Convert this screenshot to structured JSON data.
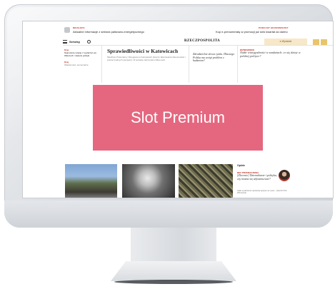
{
  "screen": {
    "top_left": {
      "tag": "NIEGLEPA",
      "text": "Aktualne informacje z sektora paliwowo-energetycznego"
    },
    "top_right": {
      "tag": "PODCAST EKONOMICZNY",
      "text": "Kup e-prenumeratę w promocji już dziś kwartał za darmo"
    },
    "nav": {
      "menu_label": "Serwisy",
      "logo": "RZECZPOSPOLITA",
      "prenum_label": "e-Wydanie"
    },
    "left_col": {
      "tag1": "Kraj",
      "text1": "Najnowsze relacje z wydarzeń we Włoszech i świecie polityki",
      "tag2": "Kraj",
      "text2": "Wiadomości, komentarze"
    },
    "center": {
      "headline": "Sprawiedliwości w Katowicach",
      "body": "Śledztwo Prokuratury Okręgowej w Katowicach dotyczy fałszowania dokumentów i prania brudnych pieniędzy. W sprawie zatrzymano kilka osób."
    },
    "right_quote": "Zdradzieckie słowa rynku. Dlaczego Polska ma wciąż problem z budżetem?",
    "right_col": {
      "tag": "BIZNESWEEK",
      "text": "Nadir wiarygodności w sondażach: co się dzieje w polskiej polityce?"
    },
    "slot_label": "Slot Premium",
    "side": {
      "title": "Opinie",
      "tag": "BEZ PRZEBACZENIA",
      "quote": "[Zlecenie] Dziennikarze i polityka, czy można się zdystansować?",
      "sub": "Jakie wydarzenie naprawdę wpłynie na rynek – twierdzi Piotr Wiśniewski"
    }
  }
}
